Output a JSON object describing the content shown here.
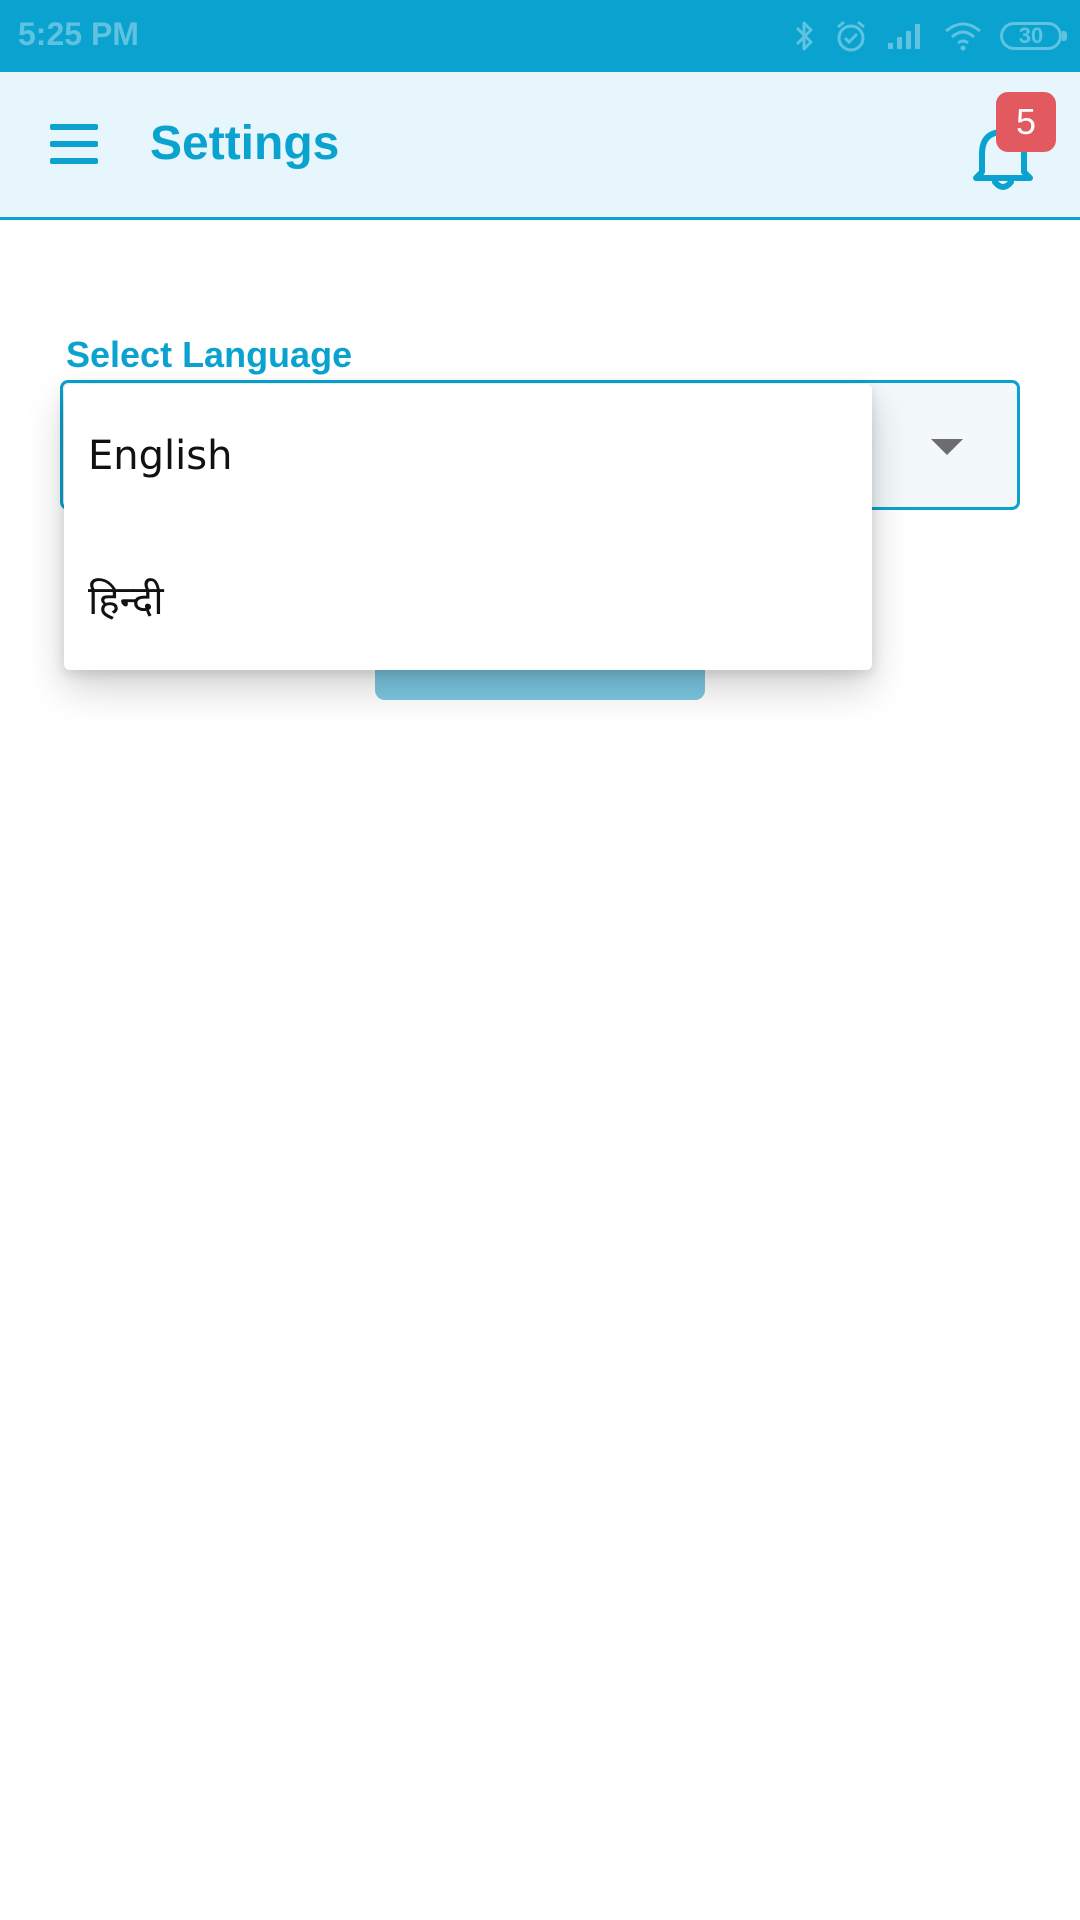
{
  "status_bar": {
    "time": "5:25 PM",
    "battery": "30",
    "icons": [
      "bluetooth-icon",
      "alarm-icon",
      "signal-icon",
      "wifi-icon",
      "battery-icon"
    ]
  },
  "app_bar": {
    "title": "Settings",
    "notification_count": "5",
    "icons": [
      "menu-icon",
      "bell-icon"
    ]
  },
  "settings": {
    "language_label": "Select Language",
    "language_options": [
      "English",
      "हिन्दी"
    ]
  },
  "colors": {
    "primary": "#0aa3cf",
    "app_bar_bg": "#e6f6fc",
    "badge": "#e25a5f",
    "button": "#7cc7e2"
  }
}
